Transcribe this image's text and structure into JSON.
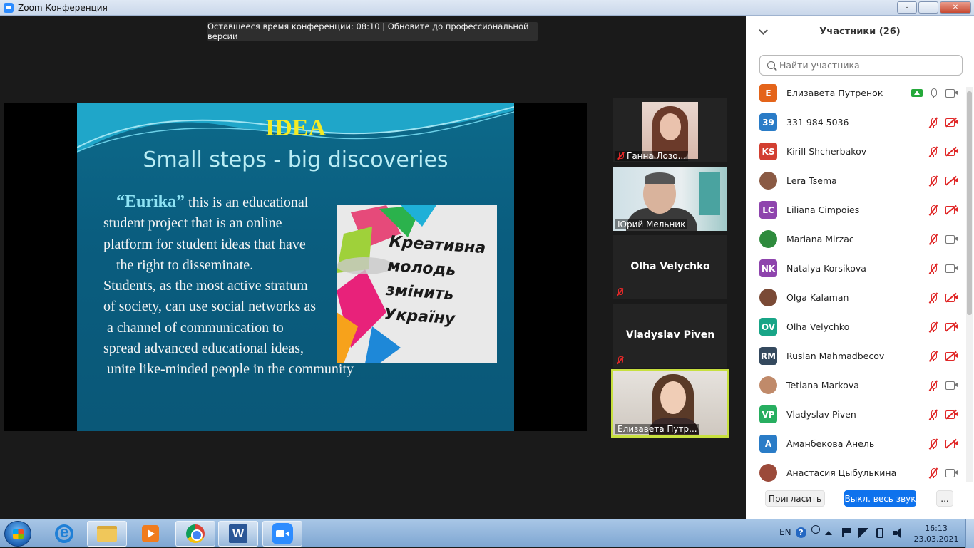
{
  "window": {
    "title": "Zoom Конференция",
    "buttons": [
      "–",
      "❐",
      "✕"
    ]
  },
  "meeting": {
    "timer_banner": "Оставшееся время конференции: 08:10 | Обновите до профессиональной версии"
  },
  "slide": {
    "title": "IDEA",
    "subtitle": "Small steps - big discoveries",
    "brand": "“Eurika”",
    "lines": [
      " this is an educational",
      "student project that is an online",
      "platform for student ideas that have",
      "the right to disseminate.",
      "Students, as the most active stratum",
      "of society, can use social networks as",
      "a channel of communication to",
      "spread advanced educational ideas,",
      "unite like-minded people in the community"
    ],
    "image_text": [
      "Креативна",
      "молодь",
      "змінить",
      "Україну"
    ]
  },
  "thumbnails": [
    {
      "name": "Ганна  Лозо...",
      "muted": true,
      "video": true
    },
    {
      "name": "Юрий Мельник",
      "muted": false,
      "video": true
    },
    {
      "name": "Olha Velychko",
      "muted": true,
      "video": false
    },
    {
      "name": "Vladyslav Piven",
      "muted": true,
      "video": false
    },
    {
      "name": "Елизавета Путр...",
      "muted": false,
      "video": true,
      "active": true
    }
  ],
  "panel": {
    "title": "Участники (26)",
    "search_placeholder": "Найти участника",
    "participants": [
      {
        "initials": "E",
        "color": "#e4641a",
        "name": "Елизавета Путренок",
        "mic_muted": false,
        "cam_off": false,
        "sharing": true
      },
      {
        "initials": "39",
        "color": "#2a7cc7",
        "name": "331 984 5036",
        "mic_muted": true,
        "cam_off": true
      },
      {
        "initials": "KS",
        "color": "#d23f31",
        "name": "Kirill Shcherbakov",
        "mic_muted": true,
        "cam_off": true
      },
      {
        "initials": "",
        "color": "#8a5a44",
        "name": "Lera Tsema",
        "mic_muted": true,
        "cam_off": true,
        "photo": true
      },
      {
        "initials": "LC",
        "color": "#8e44ad",
        "name": "Liliana Cimpoies",
        "mic_muted": true,
        "cam_off": true
      },
      {
        "initials": "",
        "color": "#2e8b3d",
        "name": "Mariana Mirzac",
        "mic_muted": true,
        "cam_off": false,
        "photo": true
      },
      {
        "initials": "NK",
        "color": "#8e44ad",
        "name": "Natalya Korsikova",
        "mic_muted": true,
        "cam_off": false
      },
      {
        "initials": "",
        "color": "#7a4a36",
        "name": "Olga Kalaman",
        "mic_muted": true,
        "cam_off": true,
        "photo": true
      },
      {
        "initials": "OV",
        "color": "#18a587",
        "name": "Olha Velychko",
        "mic_muted": true,
        "cam_off": true
      },
      {
        "initials": "RM",
        "color": "#34495e",
        "name": "Ruslan Mahmadbecov",
        "mic_muted": true,
        "cam_off": true
      },
      {
        "initials": "",
        "color": "#c08a6a",
        "name": "Tetiana Markova",
        "mic_muted": true,
        "cam_off": false,
        "photo": true
      },
      {
        "initials": "VP",
        "color": "#27ae60",
        "name": "Vladyslav Piven",
        "mic_muted": true,
        "cam_off": true
      },
      {
        "initials": "A",
        "color": "#2a7cc7",
        "name": "Аманбекова Анель",
        "mic_muted": true,
        "cam_off": true
      },
      {
        "initials": "",
        "color": "#9b4a3a",
        "name": "Анастасия Цыбулькина",
        "mic_muted": true,
        "cam_off": false,
        "photo": true
      }
    ],
    "invite_label": "Пригласить",
    "mute_all_label": "Выкл. весь звук",
    "more_label": "..."
  },
  "taskbar": {
    "language": "EN",
    "time": "16:13",
    "date": "23.03.2021"
  }
}
